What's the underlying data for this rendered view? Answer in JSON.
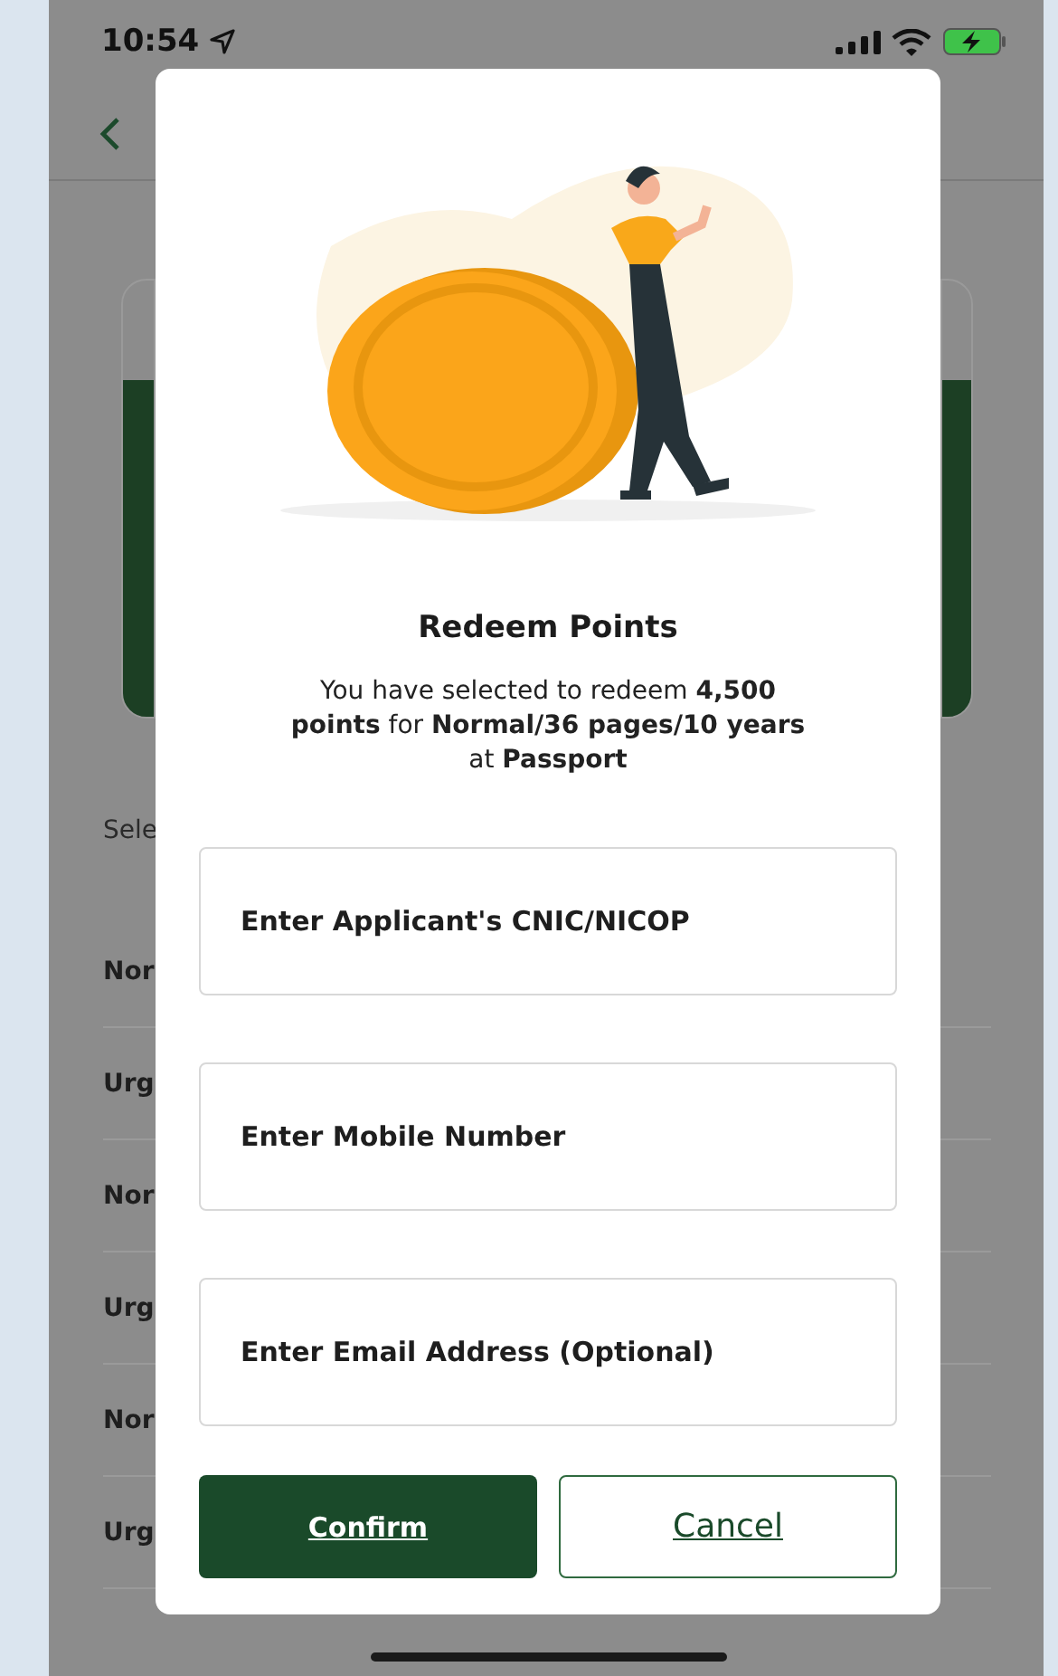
{
  "status_bar": {
    "time": "10:54"
  },
  "background": {
    "section_label": "Sele",
    "rows": [
      "Nor",
      "Urg",
      "Nor",
      "Urg",
      "Nor",
      "Urg"
    ]
  },
  "modal": {
    "title": "Redeem Points",
    "message": "You have selected to redeem **4,500 points** for **Normal/36 pages/10 years** at **Passport**",
    "fields": [
      {
        "placeholder": "Enter Applicant's CNIC/NICOP"
      },
      {
        "placeholder": "Enter Mobile Number"
      },
      {
        "placeholder": "Enter Email Address (Optional)"
      }
    ],
    "buttons": [
      {
        "label": "Confirm",
        "kind": "primary"
      },
      {
        "label": "Cancel",
        "kind": "secondary"
      }
    ]
  }
}
